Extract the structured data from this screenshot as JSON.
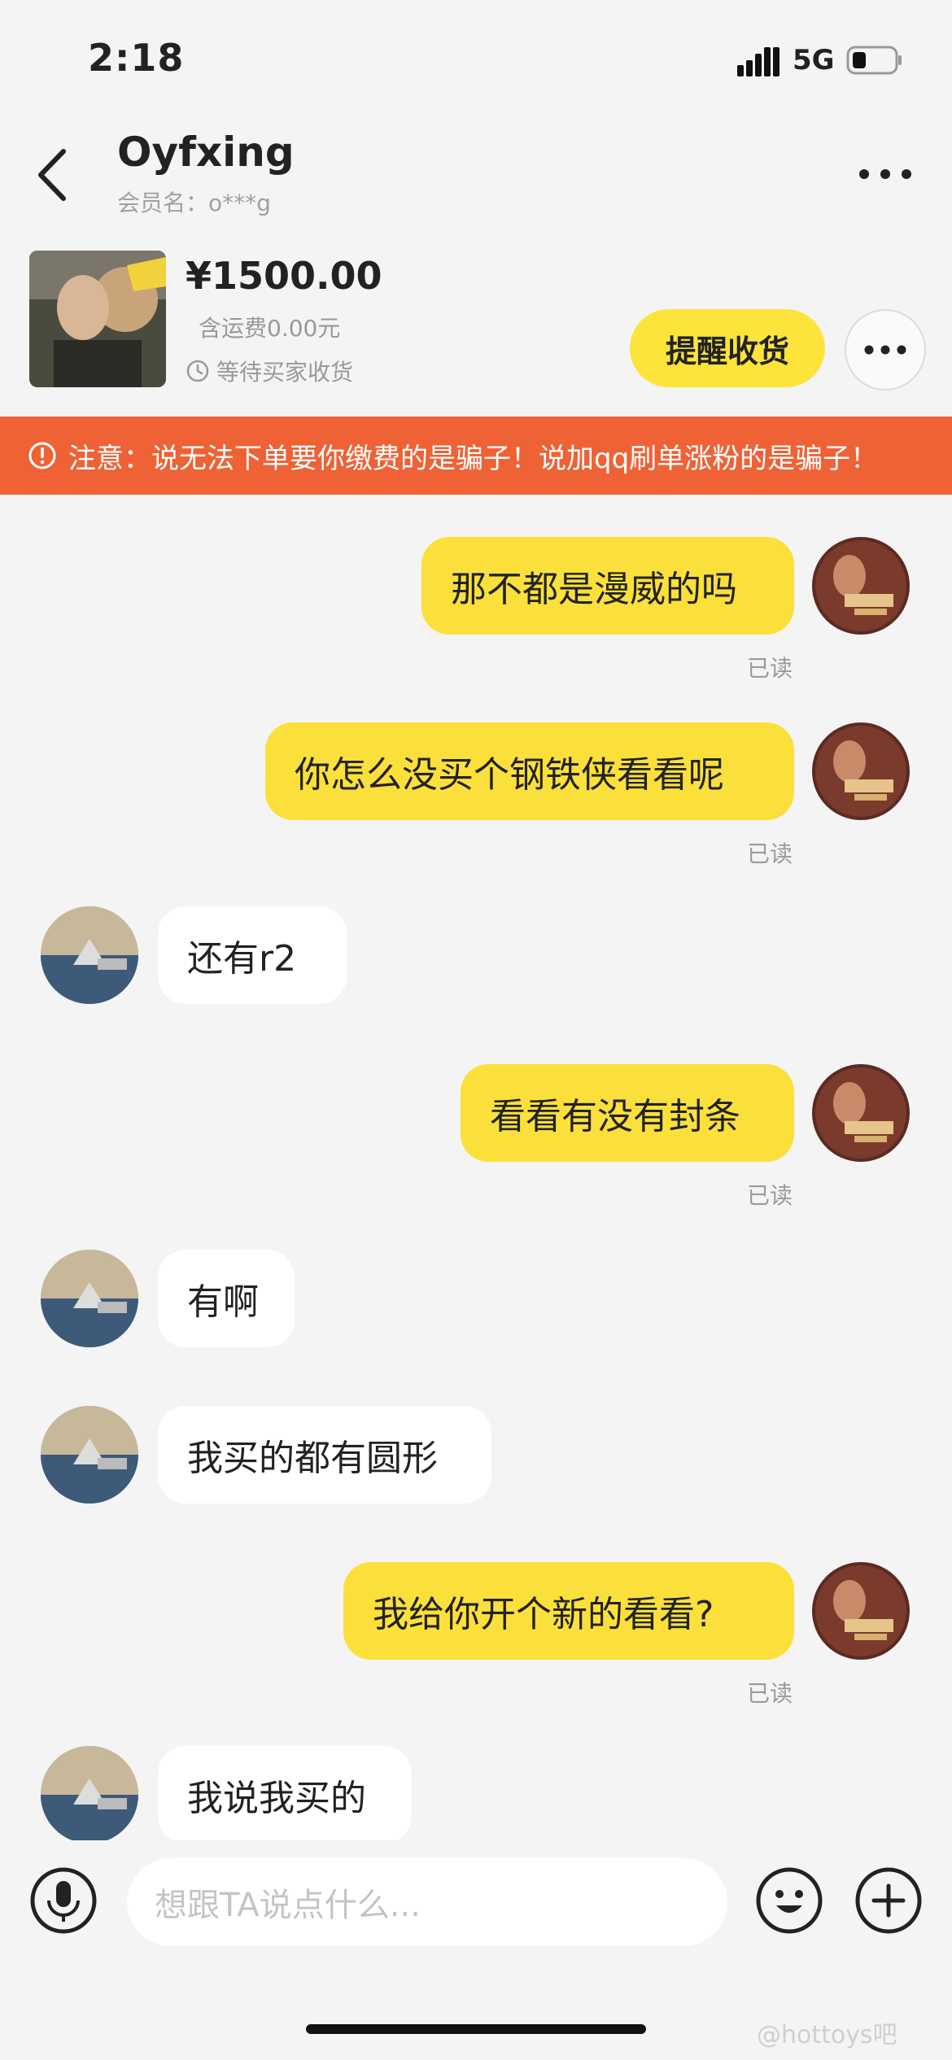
{
  "status_bar": {
    "time": "2:18",
    "network": "5G"
  },
  "header": {
    "title": "Oyfxing",
    "subtitle": "会员名：o***g"
  },
  "product": {
    "price": "¥1500.00",
    "shipping": "含运费0.00元",
    "status": "等待买家收货",
    "remind_button": "提醒收货"
  },
  "warning": {
    "text": "注意：说无法下单要你缴费的是骗子！说加qq刷单涨粉的是骗子！"
  },
  "messages": [
    {
      "from": "me",
      "text": "那不都是漫威的吗",
      "read": "已读"
    },
    {
      "from": "me",
      "text": "你怎么没买个钢铁侠看看呢",
      "read": "已读"
    },
    {
      "from": "other",
      "text": "还有r2"
    },
    {
      "from": "me",
      "text": "看看有没有封条",
      "read": "已读"
    },
    {
      "from": "other",
      "text": "有啊"
    },
    {
      "from": "other",
      "text": "我买的都有圆形"
    },
    {
      "from": "me",
      "text": "我给你开个新的看看?",
      "read": "已读"
    },
    {
      "from": "other",
      "text": "我说我买的"
    }
  ],
  "input": {
    "placeholder": "想跟TA说点什么..."
  },
  "watermark": "@hottoys吧",
  "colors": {
    "accent_yellow": "#fbe03b",
    "warning_orange": "#ee6236",
    "background": "#f4f4f4"
  }
}
